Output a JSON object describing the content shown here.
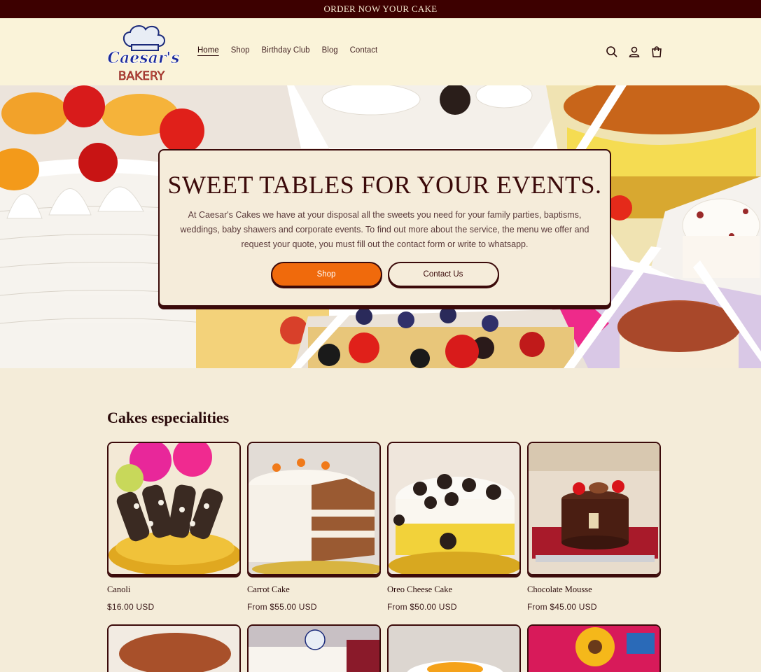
{
  "announcement": "ORDER NOW YOUR CAKE",
  "brand": {
    "name_line1": "Caesar's",
    "name_line2": "BAKERY"
  },
  "nav": [
    "Home",
    "Shop",
    "Birthday Club",
    "Blog",
    "Contact"
  ],
  "header_icons": [
    "search-icon",
    "account-icon",
    "cart-icon"
  ],
  "hero": {
    "title": "SWEET TABLES FOR YOUR EVENTS.",
    "text": "At Caesar's Cakes we have at your disposal all the sweets you need for your family parties, baptisms, weddings, baby shawers and corporate events. To find out more about the service, the menu we offer and request your quote, you must fill out the contact form or write to whatsapp.",
    "primary_button": "Shop",
    "secondary_button": "Contact Us"
  },
  "specialities": {
    "title": "Cakes especialities",
    "products": [
      {
        "name": "Canoli",
        "price": "$16.00 USD"
      },
      {
        "name": "Carrot Cake",
        "price": "From $55.00 USD"
      },
      {
        "name": "Oreo Cheese Cake",
        "price": "From $50.00 USD"
      },
      {
        "name": "Chocolate Mousse",
        "price": "From $45.00 USD"
      }
    ]
  },
  "colors": {
    "announcement_bg": "#3d0000",
    "accent": "#f06a0c",
    "page_bg": "#f4ecd9",
    "text": "#3b0a0a"
  }
}
